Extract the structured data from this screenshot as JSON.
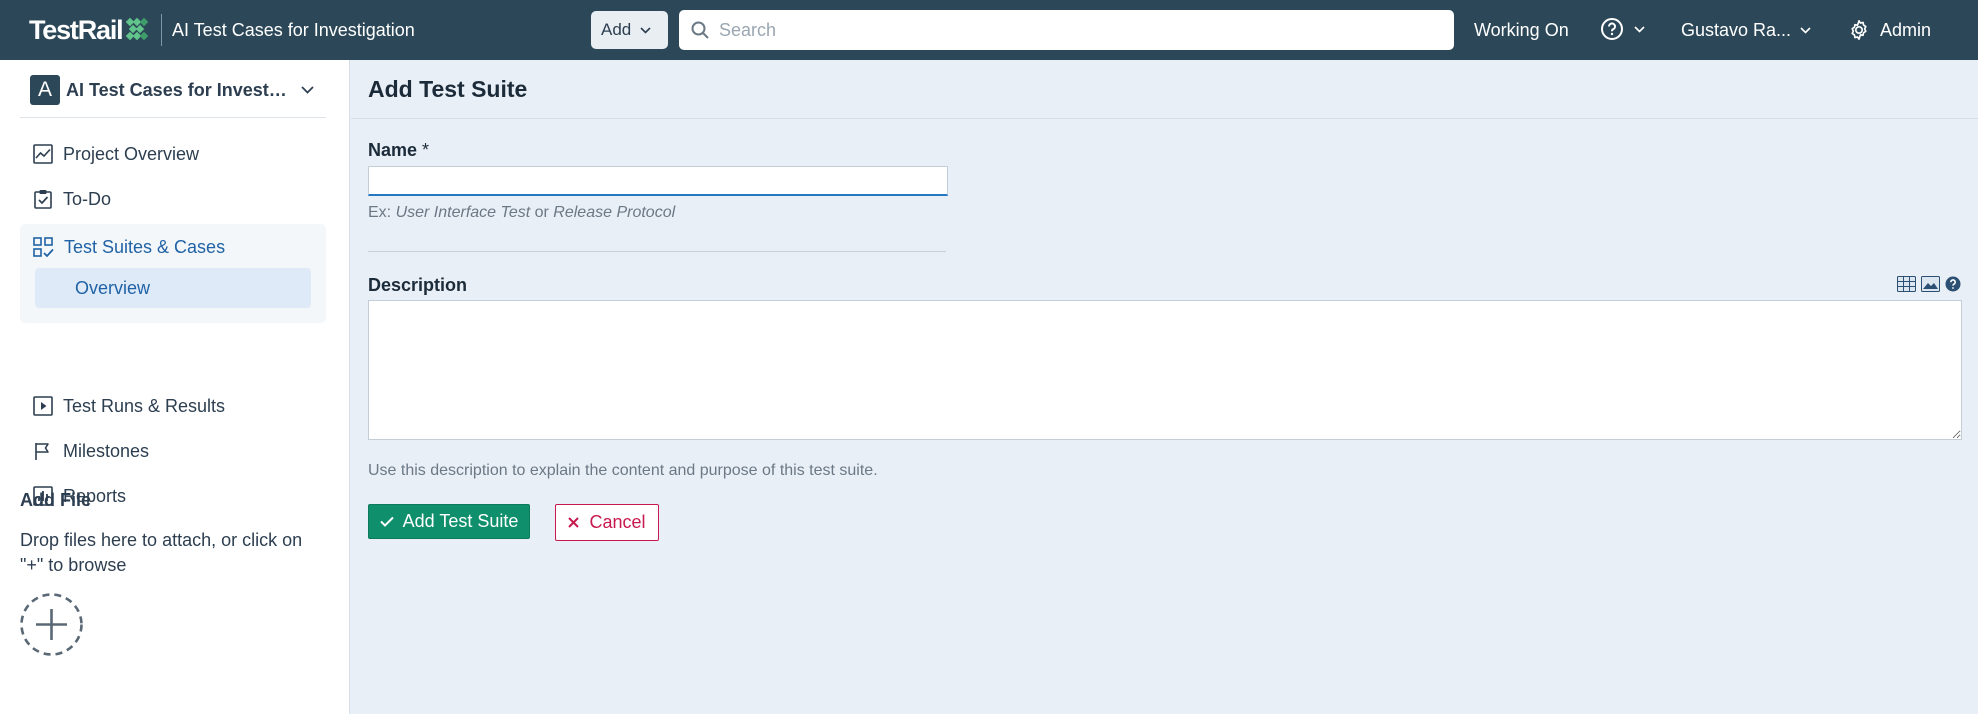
{
  "header": {
    "logo_text": "TestRail",
    "project_title": "AI Test Cases for Investigation",
    "add_label": "Add",
    "search_placeholder": "Search",
    "working_on_label": "Working On",
    "help_icon": "help-circle-icon",
    "user_label": "Gustavo Ra...",
    "admin_label": "Admin"
  },
  "sidebar": {
    "project_initial": "A",
    "project_name": "AI Test Cases for Investigation",
    "items": [
      {
        "label": "Project Overview",
        "icon": "chart-icon"
      },
      {
        "label": "To-Do",
        "icon": "clipboard-check-icon"
      },
      {
        "label": "Test Suites & Cases",
        "icon": "grid-check-icon",
        "active": true,
        "children": [
          {
            "label": "Overview",
            "active": true
          }
        ]
      },
      {
        "label": "Test Runs & Results",
        "icon": "play-box-icon"
      },
      {
        "label": "Milestones",
        "icon": "flag-icon"
      },
      {
        "label": "Reports",
        "icon": "bar-chart-icon"
      }
    ],
    "add_file": {
      "title": "Add File",
      "description": "Drop files here to attach, or click on \"+\" to browse"
    }
  },
  "main": {
    "page_title": "Add Test Suite",
    "name_field": {
      "label": "Name",
      "required_mark": "*",
      "value": "",
      "hint_prefix": "Ex:",
      "hint_example1": "User Interface Test",
      "hint_or": "or",
      "hint_example2": "Release Protocol"
    },
    "description_field": {
      "label": "Description",
      "value": "",
      "hint": "Use this description to explain the content and purpose of this test suite.",
      "toolbar_icons": [
        "table-icon",
        "image-icon",
        "help-icon"
      ]
    },
    "submit_label": "Add Test Suite",
    "cancel_label": "Cancel"
  },
  "colors": {
    "header_bg": "#2c4858",
    "accent_blue": "#1f62a5",
    "submit_green": "#0f8f6b",
    "cancel_red": "#c7194e",
    "page_bg": "#e9eff6"
  }
}
